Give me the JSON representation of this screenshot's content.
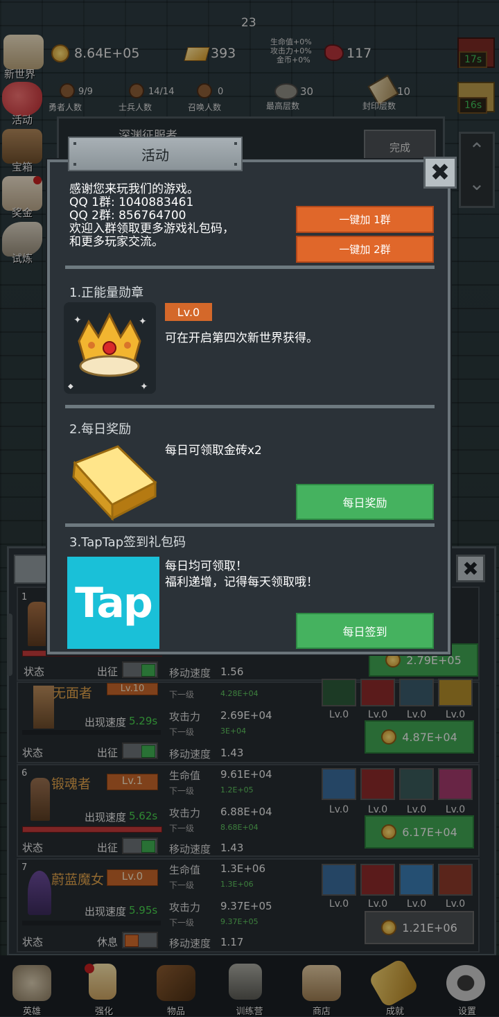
{
  "hud": {
    "fps": "23",
    "gold": "8.64E+05",
    "gold_bars": "393",
    "meat": "117",
    "buffs": [
      "生命值+0%",
      "攻击力+0%",
      "金币+0%"
    ]
  },
  "population": [
    {
      "num": "9/9",
      "label": "勇者人数"
    },
    {
      "num": "14/14",
      "label": "士兵人数"
    },
    {
      "num": "0",
      "label": "召唤人数"
    },
    {
      "num": "30",
      "label": "最高层数"
    },
    {
      "num": "10",
      "label": "封印层数"
    }
  ],
  "left_menu": [
    "新世界",
    "活动",
    "宝箱",
    "奖金",
    "试炼"
  ],
  "timers": [
    "17s",
    "16s"
  ],
  "quest": {
    "title": "深渊征服者",
    "button": "完成"
  },
  "modal": {
    "title": "活动",
    "intro": [
      "感谢您来玩我们的游戏。",
      "QQ 1群: 1040883461",
      "QQ 2群: 856764700",
      "欢迎入群领取更多游戏礼包码，",
      "和更多玩家交流。"
    ],
    "join1": "一键加 1群",
    "join2": "一键加 2群",
    "s1_title": "1.正能量勋章",
    "s1_level": "Lv.0",
    "s1_desc": "可在开启第四次新世界获得。",
    "s2_title": "2.每日奖励",
    "s2_desc": "每日可领取金砖x2",
    "s2_button": "每日奖励",
    "s3_title": "3.TapTap签到礼包码",
    "s3_logo": "Tap",
    "s3_desc1": "每日均可领取！",
    "s3_desc2": "福利递增，记得每天领取哦！",
    "s3_button": "每日签到"
  },
  "heroes": {
    "row1": {
      "index": "1",
      "status": "状态",
      "deploy": "出征",
      "move_label": "移动速度",
      "move": "1.56",
      "cost": "2.79E+05"
    },
    "row2": {
      "name": "无面者",
      "level": "Lv.10",
      "spawn_label": "出现速度",
      "spawn": "5.29s",
      "status": "状态",
      "deploy": "出征",
      "next_label": "下一级",
      "hp_next": "4.28E+04",
      "atk_label": "攻击力",
      "atk": "2.69E+04",
      "atk_next": "3E+04",
      "move_label": "移动速度",
      "move": "1.43",
      "skills": [
        "Lv.0",
        "Lv.0",
        "Lv.0",
        "Lv.0"
      ],
      "cost": "4.87E+04"
    },
    "row3": {
      "index": "6",
      "name": "锻魂者",
      "level": "Lv.1",
      "spawn_label": "出现速度",
      "spawn": "5.62s",
      "status": "状态",
      "deploy": "出征",
      "hp_label": "生命值",
      "hp": "9.61E+04",
      "next_label": "下一级",
      "hp_next": "1.2E+05",
      "atk_label": "攻击力",
      "atk": "6.88E+04",
      "atk_next": "8.68E+04",
      "move_label": "移动速度",
      "move": "1.43",
      "skills": [
        "Lv.0",
        "Lv.0",
        "Lv.0",
        "Lv.0"
      ],
      "cost": "6.17E+04"
    },
    "row4": {
      "index": "7",
      "name": "蔚蓝魔女",
      "level": "Lv.0",
      "spawn_label": "出现速度",
      "spawn": "5.95s",
      "status": "状态",
      "deploy": "休息",
      "hp_label": "生命值",
      "hp": "1.3E+06",
      "next_label": "下一级",
      "hp_next": "1.3E+06",
      "atk_label": "攻击力",
      "atk": "9.37E+05",
      "atk_next": "9.37E+05",
      "move_label": "移动速度",
      "move": "1.17",
      "skills": [
        "Lv.0",
        "Lv.0",
        "Lv.0",
        "Lv.0"
      ],
      "cost": "1.21E+06"
    }
  },
  "nav": [
    "英雄",
    "强化",
    "物品",
    "训练营",
    "商店",
    "成就",
    "设置"
  ]
}
